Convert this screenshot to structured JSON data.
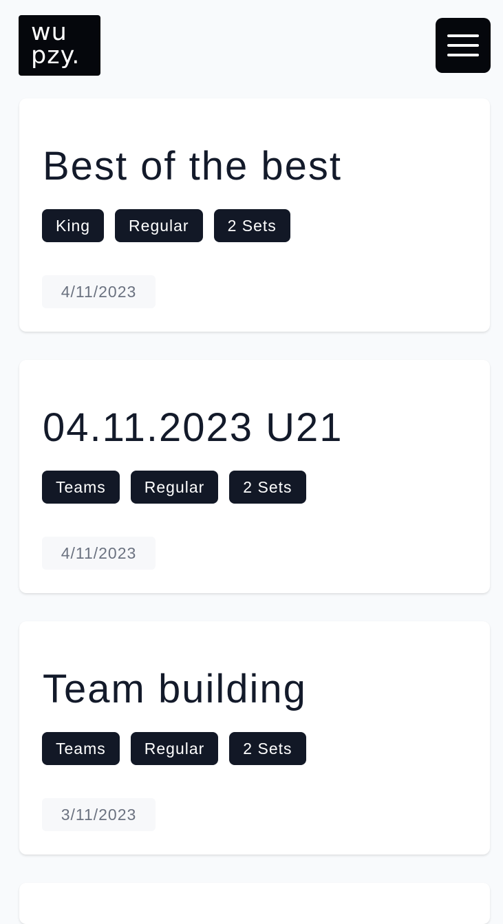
{
  "header": {
    "logo_line1": "wu",
    "logo_line2": "pzy."
  },
  "cards": [
    {
      "title": "Best of the best",
      "tags": [
        "King",
        "Regular",
        "2 Sets"
      ],
      "date": "4/11/2023"
    },
    {
      "title": "04.11.2023 U21",
      "tags": [
        "Teams",
        "Regular",
        "2 Sets"
      ],
      "date": "4/11/2023"
    },
    {
      "title": "Team building",
      "tags": [
        "Teams",
        "Regular",
        "2 Sets"
      ],
      "date": "3/11/2023"
    }
  ],
  "icons": {
    "menu": "hamburger-menu-icon"
  },
  "colors": {
    "background": "#f8fafc",
    "dark": "#05070c",
    "tag_bg": "#121826",
    "date_text": "#6b7280"
  }
}
